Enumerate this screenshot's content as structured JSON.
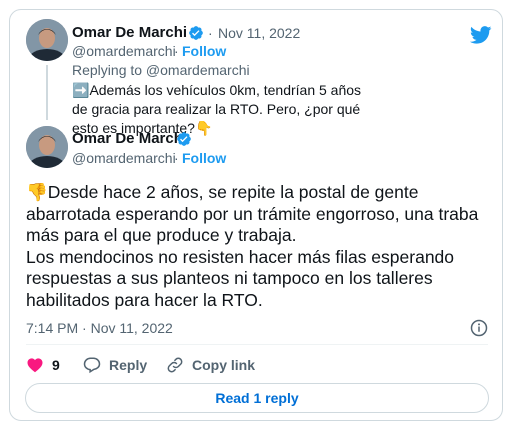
{
  "reply_tweet": {
    "author_name": "Omar De Marchi",
    "handle": "@omardemarchi",
    "separator": "·",
    "date": "Nov 11, 2022",
    "follow_label": "Follow",
    "replying_to": "Replying to @omardemarchi",
    "text_lead": "➡️",
    "text": "Además los vehículos 0km, tendrían 5 años de gracia para realizar la RTO. Pero, ¿por qué esto es importante?",
    "text_trail": "👇"
  },
  "main_tweet": {
    "author_name": "Omar De Marchi",
    "handle": "@omardemarchi",
    "separator": "·",
    "follow_label": "Follow",
    "text_lead": "👎",
    "paragraph1": "Desde hace 2 años, se repite la postal de gente abarrotada esperando por un trámite engorroso, una traba más para el que produce y trabaja.",
    "paragraph2": "Los mendocinos no resisten hacer más filas esperando respuestas a sus planteos ni tampoco en los talleres habilitados para hacer la RTO.",
    "timestamp": "7:14 PM · Nov 11, 2022"
  },
  "actions": {
    "like_count": "9",
    "reply_label": "Reply",
    "copy_link_label": "Copy link"
  },
  "read_replies_label": "Read 1 reply",
  "colors": {
    "accent": "#1d9bf0",
    "like": "#f91880",
    "text": "#0f1419",
    "muted": "#536471",
    "border": "#cfd9de"
  }
}
